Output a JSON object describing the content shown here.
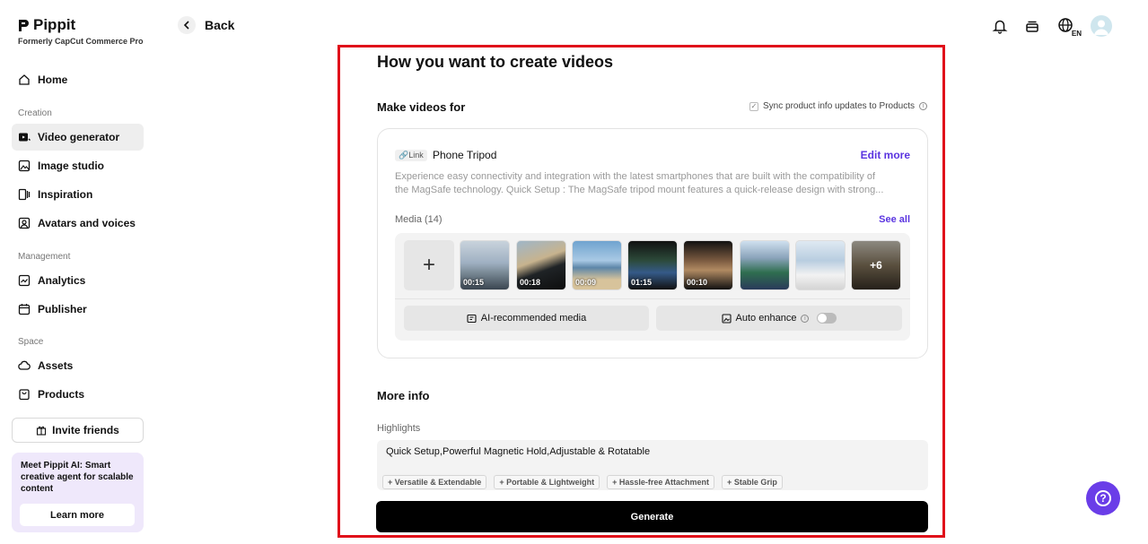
{
  "brand": {
    "name": "Pippit",
    "subtitle": "Formerly CapCut Commerce Pro"
  },
  "sidebar": {
    "home": "Home",
    "sections": {
      "creation": "Creation",
      "management": "Management",
      "space": "Space"
    },
    "items": {
      "video_generator": "Video generator",
      "image_studio": "Image studio",
      "inspiration": "Inspiration",
      "avatars": "Avatars and voices",
      "analytics": "Analytics",
      "publisher": "Publisher",
      "assets": "Assets",
      "products": "Products"
    },
    "invite": "Invite friends",
    "promo": {
      "text": "Meet Pippit AI: Smart creative agent for scalable content",
      "button": "Learn more"
    }
  },
  "header": {
    "back": "Back",
    "lang": "EN"
  },
  "main": {
    "title": "How you want to create videos",
    "make_videos_for": "Make videos for",
    "sync_label": "Sync product info updates to Products",
    "product": {
      "tag": "Link",
      "name": "Phone Tripod",
      "edit": "Edit more",
      "desc_line1": "Experience easy connectivity and integration with the latest smartphones that are built with the compatibility of",
      "desc_line2": "the MagSafe technology. Quick Setup : The MagSafe tripod mount features a quick-release design with strong..."
    },
    "media": {
      "label": "Media (14)",
      "see_all": "See all",
      "durations": [
        "00:15",
        "00:18",
        "00:09",
        "01:15",
        "00:10"
      ],
      "more": "+6",
      "ai_button": "AI-recommended media",
      "enhance": "Auto enhance"
    },
    "more_info": "More info",
    "highlights_label": "Highlights",
    "highlights_text": "Quick Setup,Powerful Magnetic Hold,Adjustable & Rotatable",
    "chips": [
      "Versatile & Extendable",
      "Portable & Lightweight",
      "Hassle-free Attachment",
      "Stable Grip"
    ],
    "generate": "Generate"
  },
  "colors": {
    "accent": "#5a34e0",
    "highlight_border": "#e0101a",
    "help_button": "#6a3de8"
  }
}
